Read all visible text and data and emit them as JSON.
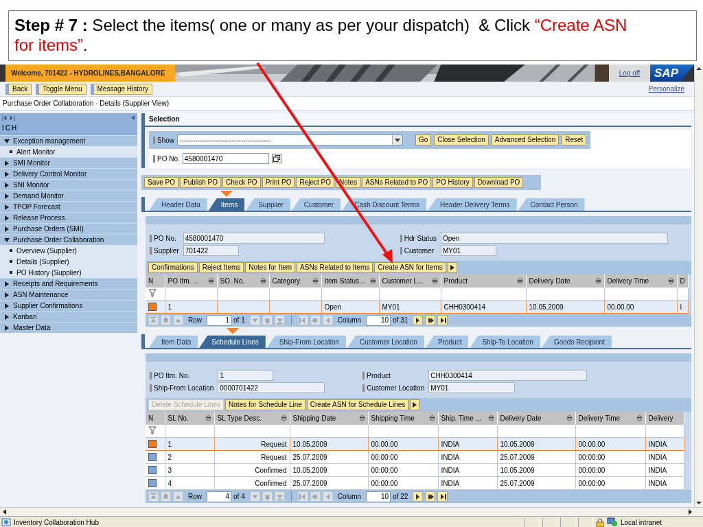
{
  "callout": {
    "parts": [
      {
        "kind": "bold",
        "text": "Step # 7 :"
      },
      {
        "kind": "plain",
        "text": " Select the items( one or many as per your dispatch)  & Click "
      },
      {
        "kind": "highlight",
        "text": "“Create ASN for items”"
      },
      {
        "kind": "plain",
        "text": "."
      }
    ]
  },
  "header": {
    "welcome": "Welcome, 701422 - HYDROLINES,BANGALORE",
    "logoff": "Log off",
    "logo": "SAP"
  },
  "toolbar": {
    "buttons": [
      "Back",
      "Toggle Menu",
      "Message History"
    ],
    "personalize": "Personalize"
  },
  "page_title": "Purchase Order Collaboration - Details (Supplier View)",
  "sidebar": {
    "title": "ICH",
    "items": [
      {
        "label": "Exception management",
        "expanded": true,
        "children": [
          {
            "label": "Alert Monitor"
          }
        ]
      },
      {
        "label": "SMI Monitor",
        "expanded": false
      },
      {
        "label": "Delivery Control Monitor",
        "expanded": false
      },
      {
        "label": "SNI Monitor",
        "expanded": false
      },
      {
        "label": "Demand Monitor",
        "expanded": false
      },
      {
        "label": "TPOP Forecast",
        "expanded": false
      },
      {
        "label": "Release Process",
        "expanded": false
      },
      {
        "label": "Purchase Orders (SMI)",
        "expanded": false
      },
      {
        "label": "Purchase Order Collaboration",
        "expanded": true,
        "children": [
          {
            "label": "Overview (Supplier)"
          },
          {
            "label": "Details (Supplier)"
          },
          {
            "label": "PO History (Supplier)"
          }
        ]
      },
      {
        "label": "Receipts and Requirements",
        "expanded": false
      },
      {
        "label": "ASN Maintenance",
        "expanded": false
      },
      {
        "label": "Supplier Confirmations",
        "expanded": false
      },
      {
        "label": "Kanban",
        "expanded": false
      },
      {
        "label": "Master Data",
        "expanded": false
      }
    ]
  },
  "selection": {
    "title": "Selection",
    "show_label": "Show",
    "show_value": "----------------------------------------",
    "buttons": [
      "Go",
      "Close Selection",
      "Advanced Selection",
      "Reset"
    ],
    "po_label": "PO No.",
    "po_value": "4580001470"
  },
  "po_actions": [
    "Save PO",
    "Publish PO",
    "Check PO",
    "Print PO",
    "Reject PO",
    "Notes",
    "ASNs Related to PO",
    "PO History",
    "Download PO"
  ],
  "tabs": [
    {
      "label": "Header Data",
      "selected": false
    },
    {
      "label": "Items",
      "selected": true
    },
    {
      "label": "Supplier",
      "selected": false
    },
    {
      "label": "Customer",
      "selected": false
    },
    {
      "label": "Cash Discount Terms",
      "selected": false
    },
    {
      "label": "Header Delivery Terms",
      "selected": false
    },
    {
      "label": "Contact Person",
      "selected": false
    }
  ],
  "header_fields": {
    "left": [
      {
        "label": "PO No.",
        "value": "4580001470"
      },
      {
        "label": "Supplier",
        "value": "701422"
      }
    ],
    "right": [
      {
        "label": "Hdr Status",
        "value": "Open"
      },
      {
        "label": "Customer",
        "value": "MY01"
      }
    ]
  },
  "item_actions": [
    {
      "label": "Confirmations",
      "disabled": false
    },
    {
      "label": "Reject Items",
      "disabled": false
    },
    {
      "label": "Notes for Item",
      "disabled": false
    },
    {
      "label": "ASNs Related to Items",
      "disabled": false
    },
    {
      "label": "Create ASN for Items",
      "disabled": false
    }
  ],
  "items_table": {
    "columns": [
      "N",
      "PO Itm. ...",
      "SO. No.",
      "Category",
      "Item Status...",
      "Customer L...",
      "Product",
      "Delivery Date",
      "Delivery Time",
      "D"
    ],
    "rows": [
      {
        "selected": true,
        "cells": [
          "",
          "1",
          "",
          "",
          "Open",
          "MY01",
          "CHH0300414",
          "10.05.2009",
          "00.00.00",
          "I"
        ]
      }
    ],
    "pager": {
      "row_label": "Row",
      "row_value": "1",
      "row_total": "of 1",
      "row_nav": [
        {
          "kind": "first",
          "disabled": true
        },
        {
          "kind": "prev_page",
          "disabled": true
        },
        {
          "kind": "prev",
          "disabled": true
        },
        {
          "kind": "next",
          "disabled": true
        },
        {
          "kind": "next_page",
          "disabled": true
        },
        {
          "kind": "last",
          "disabled": true
        }
      ],
      "column_label": "Column",
      "column_value": "10",
      "column_total": "of 31",
      "column_nav": [
        {
          "kind": "first",
          "disabled": true
        },
        {
          "kind": "prev_page",
          "disabled": true
        },
        {
          "kind": "prev",
          "disabled": true
        },
        {
          "kind": "next",
          "disabled": false
        },
        {
          "kind": "next_page",
          "disabled": false
        },
        {
          "kind": "last",
          "disabled": false
        }
      ]
    }
  },
  "detail_tabs": [
    {
      "label": "Item Data",
      "selected": false
    },
    {
      "label": "Schedule Lines",
      "selected": true
    },
    {
      "label": "Ship-From Location",
      "selected": false
    },
    {
      "label": "Customer Location",
      "selected": false
    },
    {
      "label": "Product",
      "selected": false
    },
    {
      "label": "Ship-To Location",
      "selected": false
    },
    {
      "label": "Goods Recipient",
      "selected": false
    }
  ],
  "detail_fields": {
    "left": [
      {
        "label": "PO Itm. No.",
        "value": "1"
      },
      {
        "label": "Ship-From Location",
        "value": "0000701422"
      }
    ],
    "right": [
      {
        "label": "Product",
        "value": "CHH0300414"
      },
      {
        "label": "Customer Location",
        "value": "MY01"
      }
    ]
  },
  "schedule_actions": [
    {
      "label": "Delete Schedule Lines",
      "disabled": true
    },
    {
      "label": "Notes for Schedule Line",
      "disabled": false
    },
    {
      "label": "Create ASN for Schedule Lines",
      "disabled": false
    }
  ],
  "schedule_table": {
    "columns": [
      "N",
      "SL No.",
      "SL Type Desc.",
      "Shipping Date",
      "Shipping Time",
      "Ship. Time ...",
      "Delivery Date",
      "Delivery Time",
      "Delivery"
    ],
    "rows": [
      {
        "selected": true,
        "cells": [
          "",
          "1",
          "Request",
          "10.05.2009",
          "00.00.00",
          "INDIA",
          "10.05.2009",
          "00.00.00",
          "INDIA"
        ]
      },
      {
        "selected": false,
        "cells": [
          "",
          "2",
          "Request",
          "25.07.2009",
          "00:00:00",
          "INDIA",
          "25.07.2009",
          "00:00:00",
          "INDIA"
        ]
      },
      {
        "selected": false,
        "cells": [
          "",
          "3",
          "Confirmed",
          "10.05.2009",
          "00:00:00",
          "INDIA",
          "10.05.2009",
          "00:00:00",
          "INDIA"
        ]
      },
      {
        "selected": false,
        "cells": [
          "",
          "4",
          "Confirmed",
          "25.07.2009",
          "00:00:00",
          "INDIA",
          "25.07.2009",
          "00:00:00",
          "INDIA"
        ]
      }
    ],
    "pager": {
      "row_label": "Row",
      "row_value": "4",
      "row_total": "of 4",
      "row_nav": [
        {
          "kind": "first",
          "disabled": true
        },
        {
          "kind": "prev_page",
          "disabled": true
        },
        {
          "kind": "prev",
          "disabled": true
        },
        {
          "kind": "next",
          "disabled": true
        },
        {
          "kind": "next_page",
          "disabled": true
        },
        {
          "kind": "last",
          "disabled": true
        }
      ],
      "column_label": "Column",
      "column_value": "10",
      "column_total": "of 22",
      "column_nav": [
        {
          "kind": "first",
          "disabled": true
        },
        {
          "kind": "prev_page",
          "disabled": true
        },
        {
          "kind": "prev",
          "disabled": true
        },
        {
          "kind": "next",
          "disabled": false
        },
        {
          "kind": "next_page",
          "disabled": false
        },
        {
          "kind": "last",
          "disabled": false
        }
      ]
    }
  },
  "status_bar": {
    "title": "Inventory Collaboration Hub",
    "zone": "Local intranet"
  }
}
